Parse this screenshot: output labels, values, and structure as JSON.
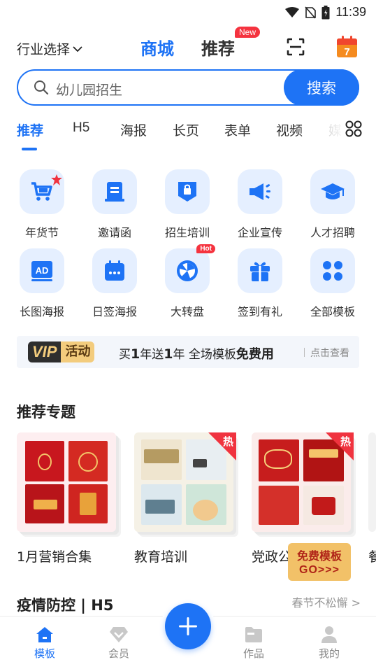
{
  "status_bar": {
    "time": "11:39"
  },
  "header": {
    "industry_select": "行业选择",
    "tab_mall": "商城",
    "tab_recommend": "推荐",
    "new_badge": "New",
    "calendar_day": "7"
  },
  "search": {
    "placeholder": "幼儿园招生",
    "button": "搜索"
  },
  "categories": {
    "items": [
      "推荐",
      "H5",
      "海报",
      "长页",
      "表单",
      "视频",
      "媒"
    ],
    "active": "推荐"
  },
  "features": [
    {
      "label": "年货节",
      "icon": "cart-icon"
    },
    {
      "label": "邀请函",
      "icon": "invitation-icon"
    },
    {
      "label": "招生培训",
      "icon": "badge-icon"
    },
    {
      "label": "企业宣传",
      "icon": "megaphone-icon"
    },
    {
      "label": "人才招聘",
      "icon": "graduation-cap-icon"
    },
    {
      "label": "长图海报",
      "icon": "ad-icon"
    },
    {
      "label": "日签海报",
      "icon": "calendar-icon"
    },
    {
      "label": "大转盘",
      "icon": "wheel-icon",
      "badge": "Hot"
    },
    {
      "label": "签到有礼",
      "icon": "gift-icon"
    },
    {
      "label": "全部模板",
      "icon": "apps-icon"
    }
  ],
  "vip_banner": {
    "vip": "VIP",
    "activity": "活动",
    "promo_prefix": "买",
    "promo_num1": "1",
    "promo_mid": "年送",
    "promo_num2": "1",
    "promo_mid2": "年 全场模板",
    "promo_free": "免费用",
    "check": "点击查看"
  },
  "recommended": {
    "title": "推荐专题",
    "topics": [
      {
        "name": "1月营销合集",
        "hot": false
      },
      {
        "name": "教育培训",
        "hot": true,
        "hot_label": "热"
      },
      {
        "name": "党政公",
        "hot": true,
        "hot_label": "热"
      },
      {
        "name": "餐"
      }
    ],
    "free_badge": {
      "line1": "免费模板",
      "line2": "GO>>>"
    }
  },
  "epidemic": {
    "title": "疫情防控 | H5",
    "more": "春节不松懈 >"
  },
  "bottom_nav": {
    "items": [
      {
        "label": "模板",
        "active": true
      },
      {
        "label": "会员",
        "active": false
      },
      {
        "label": "作品",
        "active": false
      },
      {
        "label": "我的",
        "active": false
      }
    ]
  },
  "colors": {
    "accent": "#1e73f5",
    "hot": "#f5333f",
    "gold": "#f2c168"
  }
}
